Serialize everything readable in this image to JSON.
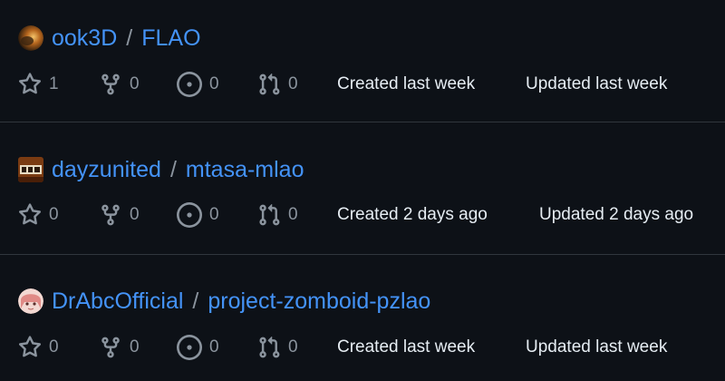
{
  "colors": {
    "background": "#0d1117",
    "link": "#4493f8",
    "muted": "#8b949e",
    "text": "#e6edf3",
    "divider": "#30363d"
  },
  "repos": [
    {
      "owner": "ook3D",
      "separator": "/",
      "name": "FLAO",
      "avatar_icon": "avatar-ook3D-icon",
      "stars": "1",
      "forks": "0",
      "issues": "0",
      "pull_requests": "0",
      "created": "Created last week",
      "updated": "Updated last week"
    },
    {
      "owner": "dayzunited",
      "separator": "/",
      "name": "mtasa-mlao",
      "avatar_icon": "avatar-dayzunited-icon",
      "stars": "0",
      "forks": "0",
      "issues": "0",
      "pull_requests": "0",
      "created": "Created 2 days ago",
      "updated": "Updated 2 days ago"
    },
    {
      "owner": "DrAbcOfficial",
      "separator": "/",
      "name": "project-zomboid-pzlao",
      "avatar_icon": "avatar-drabcofficial-icon",
      "stars": "0",
      "forks": "0",
      "issues": "0",
      "pull_requests": "0",
      "created": "Created last week",
      "updated": "Updated last week"
    }
  ],
  "icons": {
    "star": "star-icon",
    "fork": "fork-icon",
    "issue": "issue-icon",
    "pull_request": "pull-request-icon"
  }
}
